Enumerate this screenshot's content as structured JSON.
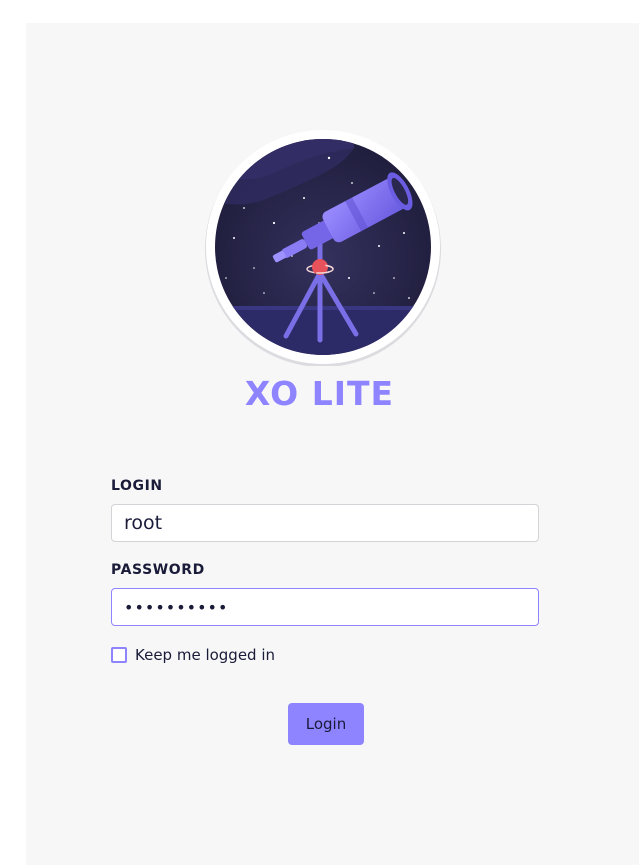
{
  "brand": {
    "name": "XO LITE",
    "accent_color": "#8f84ff",
    "logo_icon": "telescope-icon"
  },
  "form": {
    "login_label": "LOGIN",
    "login_value": "root",
    "password_label": "PASSWORD",
    "password_value": "••••••••••",
    "remember_label": "Keep me logged in",
    "remember_checked": false,
    "submit_label": "Login"
  },
  "colors": {
    "text": "#1a1b38",
    "panel_bg": "#f7f7f8",
    "logo_bg": "#1e1c3a"
  }
}
